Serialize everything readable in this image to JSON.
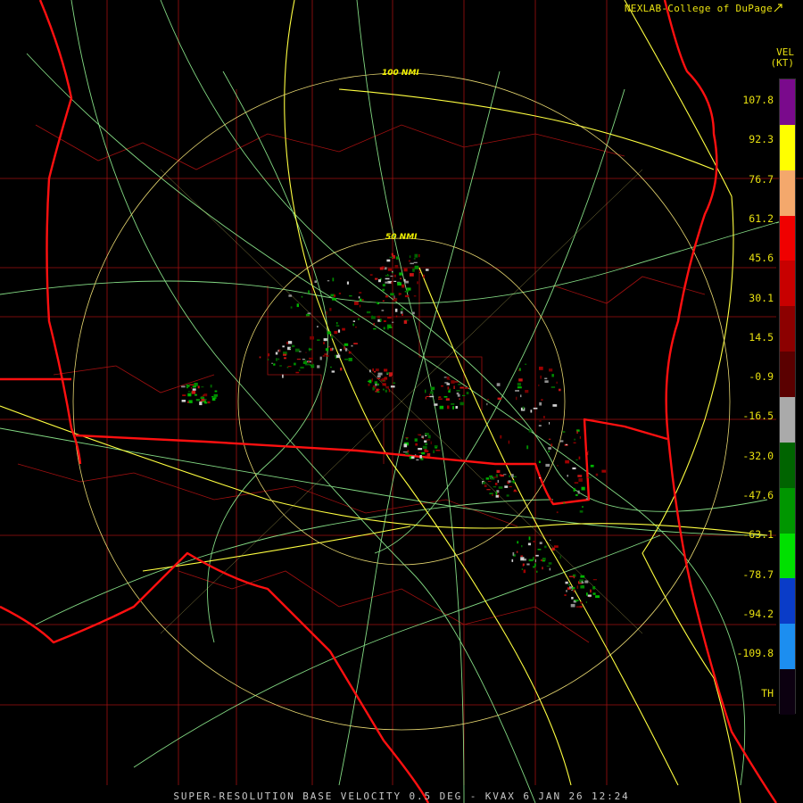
{
  "credit": "NEXLAB-College of DuPage",
  "unit": {
    "product": "VEL",
    "units": "(KT)"
  },
  "rings": [
    {
      "label": "50 NMI",
      "radius_nmi": 50
    },
    {
      "label": "100 NMI",
      "radius_nmi": 100
    }
  ],
  "colorbar": {
    "labels": [
      "107.8",
      "92.3",
      "76.7",
      "61.2",
      "45.6",
      "30.1",
      "14.5",
      "-0.9",
      "-16.5",
      "-32.0",
      "-47.6",
      "-63.1",
      "-78.7",
      "-94.2",
      "-109.8",
      "TH"
    ],
    "segments": [
      {
        "color": "#7a0a8c"
      },
      {
        "color": "#ffff00"
      },
      {
        "color": "#f4a86c"
      },
      {
        "color": "#f00000"
      },
      {
        "color": "#c80000"
      },
      {
        "color": "#8c0000"
      },
      {
        "color": "#5a0000"
      },
      {
        "color": "#aaaaaa"
      },
      {
        "color": "#006400"
      },
      {
        "color": "#009600"
      },
      {
        "color": "#00e000"
      },
      {
        "color": "#0a3cc8"
      },
      {
        "color": "#1c8ef0"
      },
      {
        "color": "#0c0010"
      }
    ]
  },
  "colors": {
    "state_border": "#ff1010",
    "county_border": "#a01010",
    "highway": "#ffff40",
    "road": "#9aff9a",
    "range_ring": "#e8d870",
    "accent": "#e8e010"
  },
  "footer": "SUPER-RESOLUTION BASE VELOCITY 0.5 DEG - KVAX 6 JAN 26 12:24"
}
